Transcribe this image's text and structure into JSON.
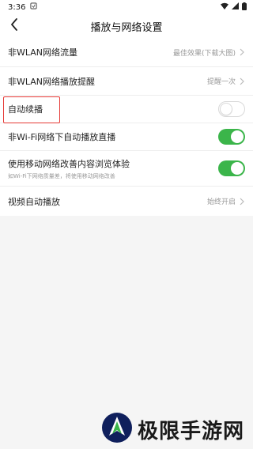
{
  "status_bar": {
    "time": "3:36",
    "icons": [
      "notification-icon",
      "wifi-icon",
      "signal-icon",
      "battery-icon"
    ]
  },
  "nav": {
    "title": "播放与网络设置",
    "back_icon": "chevron-left-icon"
  },
  "settings": [
    {
      "label": "非WLAN网络流量",
      "value": "最佳效果(下载大图)",
      "control": "chevron"
    },
    {
      "label": "非WLAN网络播放提醒",
      "value": "提醒一次",
      "control": "chevron"
    },
    {
      "label": "自动续播",
      "control": "toggle",
      "on": false,
      "highlighted": true
    },
    {
      "label": "非Wi-Fi网络下自动播放直播",
      "control": "toggle",
      "on": true
    },
    {
      "label": "使用移动网络改善内容浏览体验",
      "sub": "如Wi-Fi下网络质量差，将使用移动网络改善",
      "control": "toggle",
      "on": true
    },
    {
      "label": "视频自动播放",
      "value": "始终开启",
      "control": "chevron"
    }
  ],
  "colors": {
    "accent_green": "#3bb54a",
    "highlight_red": "#e53935",
    "background": "#f5f5f5"
  },
  "watermark": {
    "text": "极限手游网",
    "logo_icon": "shield-logo-icon"
  }
}
